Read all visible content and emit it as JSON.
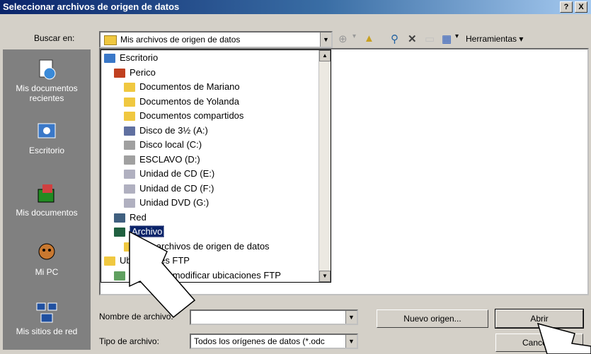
{
  "dialog": {
    "title": "Seleccionar archivos de origen de datos",
    "help_btn": "?",
    "close_btn": "X"
  },
  "toolbar": {
    "look_in_label": "Buscar en:",
    "look_in_value": "Mis archivos de origen de datos",
    "tools_label": "Herramientas"
  },
  "places": [
    {
      "label": "Mis documentos recientes",
      "icon": "recent-documents-icon"
    },
    {
      "label": "Escritorio",
      "icon": "desktop-icon"
    },
    {
      "label": "Mis documentos",
      "icon": "my-documents-icon"
    },
    {
      "label": "Mi PC",
      "icon": "my-computer-icon"
    },
    {
      "label": "Mis sitios de red",
      "icon": "network-places-icon"
    }
  ],
  "dropdown_items": [
    {
      "label": "Escritorio",
      "indent": 0,
      "icon": "desktop-icon",
      "color": "#3a78c8"
    },
    {
      "label": "Perico",
      "indent": 1,
      "icon": "user-folder-icon",
      "color": "#c04020"
    },
    {
      "label": "Documentos de Mariano",
      "indent": 2,
      "icon": "folder-icon",
      "color": "#f0c840"
    },
    {
      "label": "Documentos de Yolanda",
      "indent": 2,
      "icon": "folder-icon",
      "color": "#f0c840"
    },
    {
      "label": "Documentos compartidos",
      "indent": 2,
      "icon": "folder-icon",
      "color": "#f0c840"
    },
    {
      "label": "Disco de 3½ (A:)",
      "indent": 2,
      "icon": "floppy-icon",
      "color": "#6070a0"
    },
    {
      "label": "Disco local (C:)",
      "indent": 2,
      "icon": "hard-drive-icon",
      "color": "#a0a0a0"
    },
    {
      "label": "ESCLAVO (D:)",
      "indent": 2,
      "icon": "hard-drive-icon",
      "color": "#a0a0a0"
    },
    {
      "label": "Unidad de CD (E:)",
      "indent": 2,
      "icon": "cd-drive-icon",
      "color": "#b0b0c0"
    },
    {
      "label": "Unidad de CD (F:)",
      "indent": 2,
      "icon": "cd-drive-icon",
      "color": "#b0b0c0"
    },
    {
      "label": "Unidad DVD (G:)",
      "indent": 2,
      "icon": "dvd-drive-icon",
      "color": "#b0b0c0"
    },
    {
      "label": "Red",
      "indent": 1,
      "icon": "network-icon",
      "color": "#406080"
    },
    {
      "label": "Archivo",
      "indent": 1,
      "icon": "archive-icon",
      "color": "#206040",
      "selected": true
    },
    {
      "label": "Mis archivos de origen de datos",
      "indent": 2,
      "icon": "data-source-folder-icon",
      "color": "#f0c840"
    },
    {
      "label": "Ubicaciones FTP",
      "indent": 0,
      "icon": "folder-icon",
      "color": "#f0c840"
    },
    {
      "label": "Agregar o modificar ubicaciones FTP",
      "indent": 1,
      "icon": "ftp-icon",
      "color": "#60a060"
    }
  ],
  "filename": {
    "label": "Nombre de archivo:",
    "value": ""
  },
  "filetype": {
    "label": "Tipo de archivo:",
    "value": "Todos los orígenes de datos (*.odc"
  },
  "buttons": {
    "new_source": "Nuevo origen...",
    "open": "Abrir",
    "cancel": "Cancelar"
  }
}
